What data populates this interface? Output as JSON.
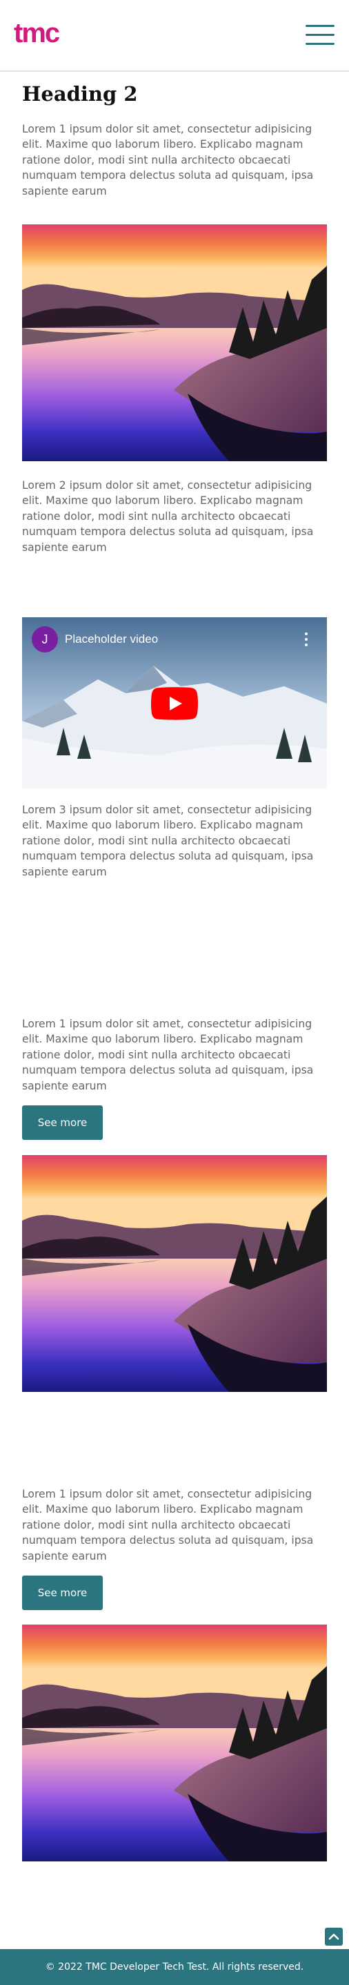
{
  "header": {
    "logo": "tmc",
    "menu_icon": "hamburger-menu-icon"
  },
  "main": {
    "heading": "Heading 2",
    "paragraph_1": "Lorem 1 ipsum dolor sit amet, consectetur adipisicing elit. Maxime quo laborum libero. Explicabo magnam ratione dolor, modi sint nulla architecto obcaecati numquam tempora delectus soluta ad quisquam, ipsa sapiente earum",
    "paragraph_2": "Lorem 2 ipsum dolor sit amet, consectetur adipisicing elit. Maxime quo laborum libero. Explicabo magnam ratione dolor, modi sint nulla architecto obcaecati numquam tempora delectus soluta ad quisquam, ipsa sapiente earum",
    "video": {
      "avatar_letter": "J",
      "title": "Placeholder video",
      "play_icon": "youtube-play-icon",
      "more_icon": "more-vertical-icon"
    },
    "paragraph_3": "Lorem 3 ipsum dolor sit amet, consectetur adipisicing elit. Maxime quo laborum libero. Explicabo magnam ratione dolor, modi sint nulla architecto obcaecati numquam tempora delectus soluta ad quisquam, ipsa sapiente earum",
    "card_1": {
      "text": "Lorem 1 ipsum dolor sit amet, consectetur adipisicing elit. Maxime quo laborum libero. Explicabo magnam ratione dolor, modi sint nulla architecto obcaecati numquam tempora delectus soluta ad quisquam, ipsa sapiente earum",
      "button": "See more"
    },
    "card_2": {
      "text": "Lorem 1 ipsum dolor sit amet, consectetur adipisicing elit. Maxime quo laborum libero. Explicabo magnam ratione dolor, modi sint nulla architecto obcaecati numquam tempora delectus soluta ad quisquam, ipsa sapiente earum",
      "button": "See more"
    }
  },
  "back_to_top_icon": "chevron-up-icon",
  "footer": {
    "copyright": "© 2022 TMC Developer Tech Test. All rights reserved."
  },
  "colors": {
    "brand_pink": "#d3197e",
    "accent_teal": "#2a7580",
    "text_grey": "#666666"
  }
}
